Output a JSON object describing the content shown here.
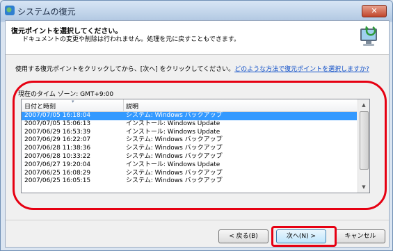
{
  "window": {
    "title": "システムの復元",
    "close_label": "✕"
  },
  "header": {
    "title": "復元ポイントを選択してください。",
    "subtitle": "ドキュメントの変更や削除は行われません。処理を元に戻すこともできます。"
  },
  "instruction": {
    "text": "使用する復元ポイントをクリックしてから、[次へ] をクリックしてください。",
    "link": "どのような方法で復元ポイントを選択しますか?"
  },
  "timezone": "現在のタイム ゾーン: GMT+9:00",
  "list": {
    "columns": [
      "日付と時刻",
      "説明"
    ],
    "rows": [
      {
        "date": "2007/07/05 16:18:04",
        "desc": "システム: Windows バックアップ",
        "selected": true
      },
      {
        "date": "2007/07/05 15:06:13",
        "desc": "インストール: Windows Update"
      },
      {
        "date": "2007/06/29 16:53:39",
        "desc": "インストール: Windows Update"
      },
      {
        "date": "2007/06/29 16:22:07",
        "desc": "システム: Windows バックアップ"
      },
      {
        "date": "2007/06/28 11:38:36",
        "desc": "システム: Windows バックアップ"
      },
      {
        "date": "2007/06/28 10:33:22",
        "desc": "システム: Windows バックアップ"
      },
      {
        "date": "2007/06/27 19:20:04",
        "desc": "インストール: Windows Update"
      },
      {
        "date": "2007/06/25 16:08:29",
        "desc": "システム: Windows バックアップ"
      },
      {
        "date": "2007/06/25 16:05:15",
        "desc": "システム: Windows バックアップ"
      }
    ]
  },
  "buttons": {
    "back": "< 戻る(B)",
    "next": "次へ(N) >",
    "cancel": "キャンセル"
  },
  "colors": {
    "highlight": "#e60012",
    "selection": "#3399ff",
    "link": "#1150c8"
  }
}
